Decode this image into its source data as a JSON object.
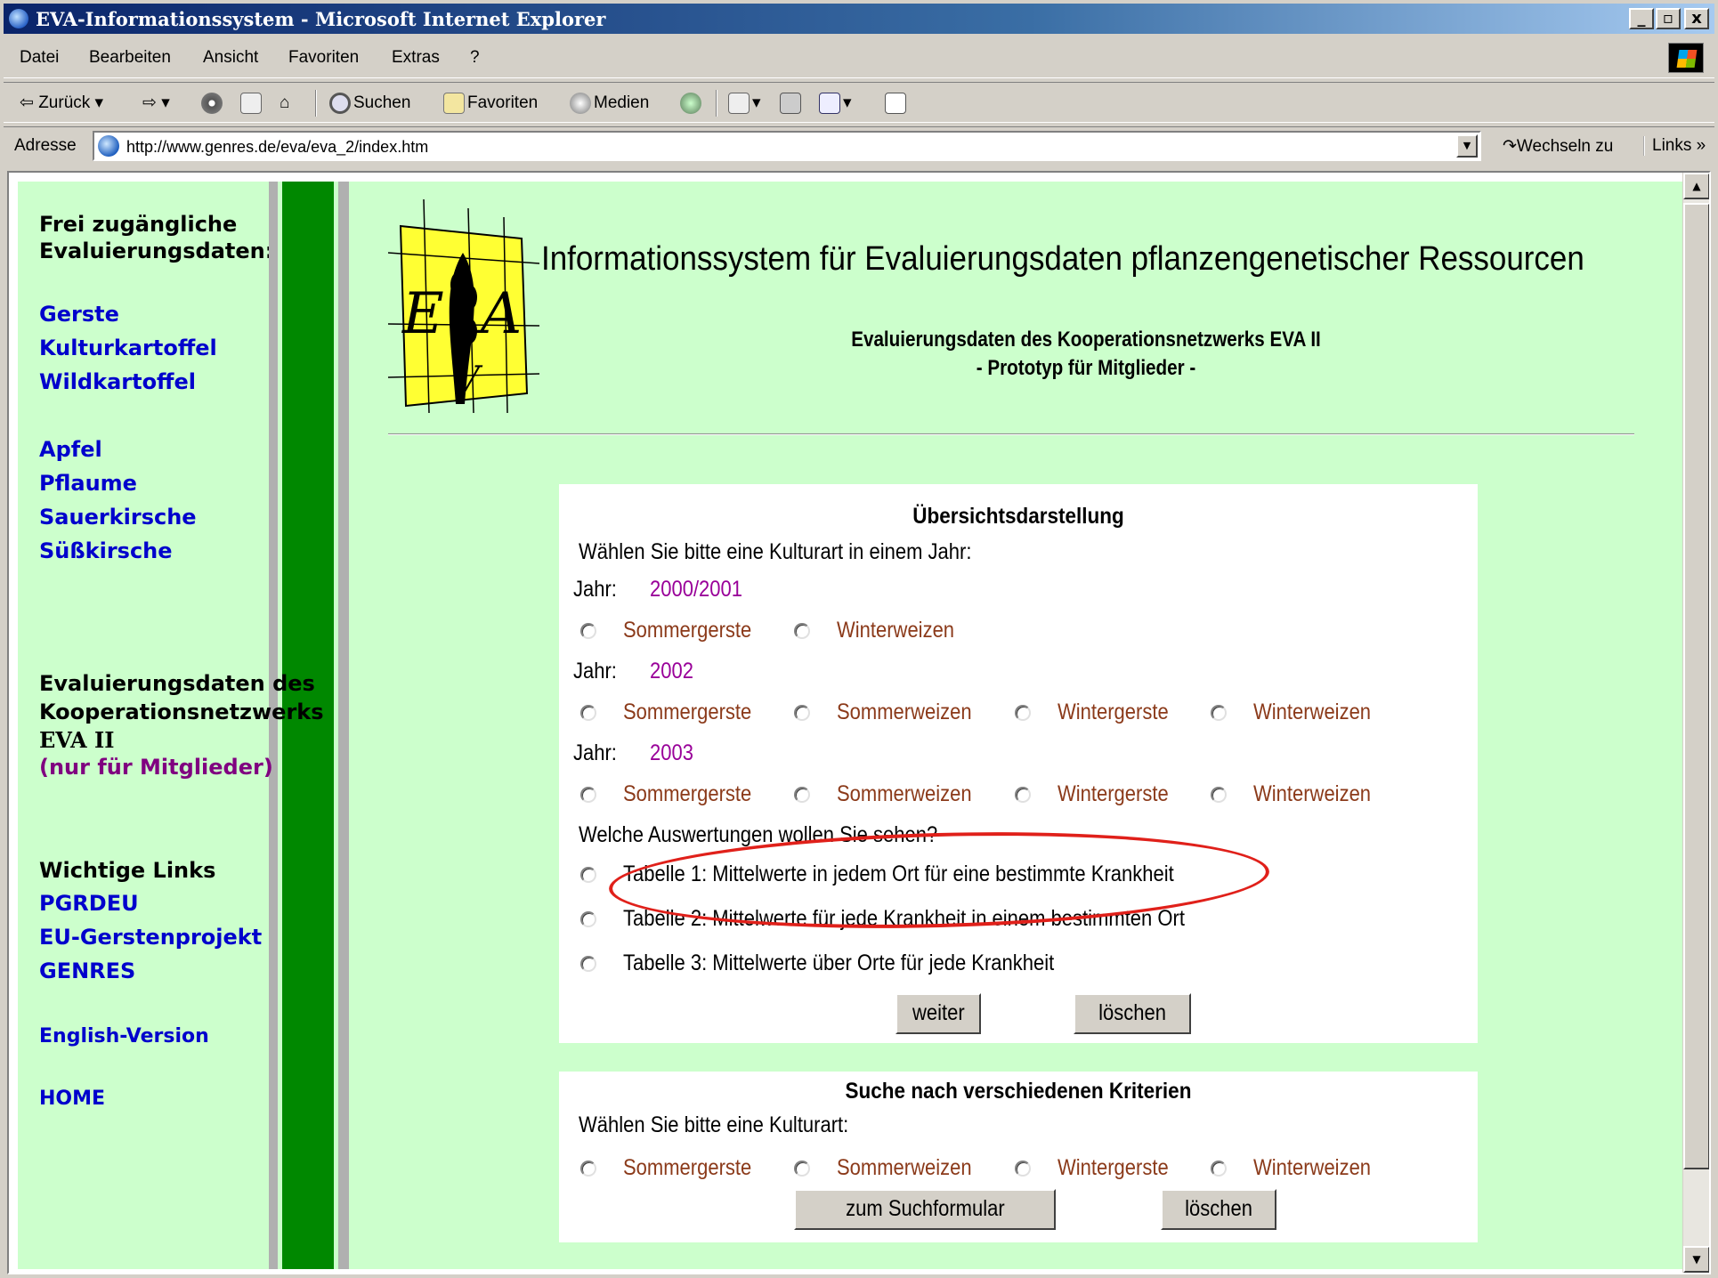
{
  "window": {
    "title": "EVA-Informationssystem - Microsoft Internet Explorer",
    "buttons": {
      "minimize": "_",
      "maximize": "▫",
      "close": "x"
    }
  },
  "menu": [
    "Datei",
    "Bearbeiten",
    "Ansicht",
    "Favoriten",
    "Extras",
    "?"
  ],
  "toolbar": {
    "back": "Zurück",
    "search": "Suchen",
    "favorites": "Favoriten",
    "media": "Medien"
  },
  "address": {
    "label": "Adresse",
    "url": "http://www.genres.de/eva/eva_2/index.htm",
    "go": "Wechseln zu",
    "links": "Links"
  },
  "sidebar": {
    "free_heading_1": "Frei zugängliche",
    "free_heading_2": "Evaluierungsdaten:",
    "crops_a": [
      "Gerste",
      "Kulturkartoffel",
      "Wildkartoffel"
    ],
    "crops_b": [
      "Apfel",
      "Pflaume",
      "Sauerkirsche",
      "Süßkirsche"
    ],
    "eva_heading_1": "Evaluierungsdaten des",
    "eva_heading_2": "Kooperationsnetzwerks",
    "eva_heading_3": "EVA II",
    "eva_members": "(nur für Mitglieder)",
    "links_heading": "Wichtige Links",
    "links": [
      "PGRDEU",
      "EU-Gerstenprojekt",
      "GENRES"
    ],
    "english": "English-Version",
    "home": "HOME"
  },
  "header": {
    "title": "Informationssystem für Evaluierungsdaten pflanzengenetischer Ressourcen",
    "subtitle_1": "Evaluierungsdaten des Kooperationsnetzwerks EVA II",
    "subtitle_2": "- Prototyp für Mitglieder -",
    "logo_text": "EVA"
  },
  "overview": {
    "title": "Übersichtsdarstellung",
    "prompt": "Wählen Sie bitte eine Kulturart in einem Jahr:",
    "year_label": "Jahr:",
    "years": [
      {
        "year": "2000/2001",
        "options": [
          "Sommergerste",
          "Winterweizen"
        ]
      },
      {
        "year": "2002",
        "options": [
          "Sommergerste",
          "Sommerweizen",
          "Wintergerste",
          "Winterweizen"
        ]
      },
      {
        "year": "2003",
        "options": [
          "Sommergerste",
          "Sommerweizen",
          "Wintergerste",
          "Winterweizen"
        ]
      }
    ],
    "analysis_prompt": "Welche Auswertungen wollen Sie sehen?",
    "tables": [
      "Tabelle 1: Mittelwerte in jedem Ort für eine bestimmte Krankheit",
      "Tabelle 2: Mittelwerte für jede Krankheit in einem bestimmten Ort",
      "Tabelle 3: Mittelwerte über Orte für jede Krankheit"
    ],
    "submit": "weiter",
    "reset": "löschen"
  },
  "search": {
    "title": "Suche nach verschiedenen Kriterien",
    "prompt": "Wählen Sie bitte eine Kulturart:",
    "options": [
      "Sommergerste",
      "Sommerweizen",
      "Wintergerste",
      "Winterweizen"
    ],
    "submit": "zum Suchformular",
    "reset": "löschen"
  },
  "colors": {
    "page_bg": "#ccffcc",
    "nav_link": "#0000cc",
    "year": "#990099",
    "option": "#8b3a1a",
    "highlight": "#e0201a",
    "green_stripe": "#008800"
  }
}
